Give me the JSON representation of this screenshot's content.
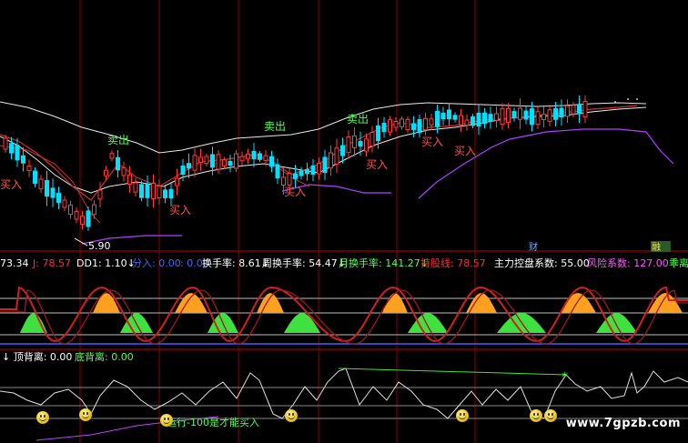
{
  "price_panel": {
    "low_price_label": "5.90",
    "buy_label": "买入",
    "sell_label": "卖出",
    "cai_badge": "财",
    "rong_badge": "融"
  },
  "indicator_bar": {
    "items": [
      {
        "text": "73.34",
        "color": "#ffffff"
      },
      {
        "text": "J: 78.57",
        "color": "#ff3030"
      },
      {
        "text": "DD1: 1.10",
        "color": "#ffffff"
      },
      {
        "text": "分入: 0.00",
        "color": "#3b6bff"
      },
      {
        "text": ": 0.00",
        "color": "#3b6bff"
      },
      {
        "text": "换手率: 8.61",
        "color": "#ffffff"
      },
      {
        "text": "周换手率: 54.47",
        "color": "#ffffff"
      },
      {
        "text": "月换手率: 141.27",
        "color": "#55ff55"
      },
      {
        "text": "持股线: 78.57",
        "color": "#ff3030"
      },
      {
        "text": "主力控盘系数: 55.00",
        "color": "#ffffff"
      },
      {
        "text": "风险系数: 127.00",
        "color": "#ff55ff"
      },
      {
        "text": "乖离",
        "color": "#55ff55"
      }
    ]
  },
  "bottom_panel": {
    "top_divergence": "顶背离: 0.00",
    "bottom_divergence": "底背离: 0.00",
    "note": "运行-100是才能买入"
  },
  "watermark": "www.7gpzb.com",
  "colors": {
    "background": "#000000",
    "up_candle": "#ff3b3b",
    "down_candle": "#00e0ff",
    "boll_band": "#e0e0e0",
    "lower_band": "#b040ff",
    "ma_line": "#d04040",
    "orange_fill": "#ffa020",
    "green_fill": "#40e040",
    "panel_border": "#c00000"
  }
}
